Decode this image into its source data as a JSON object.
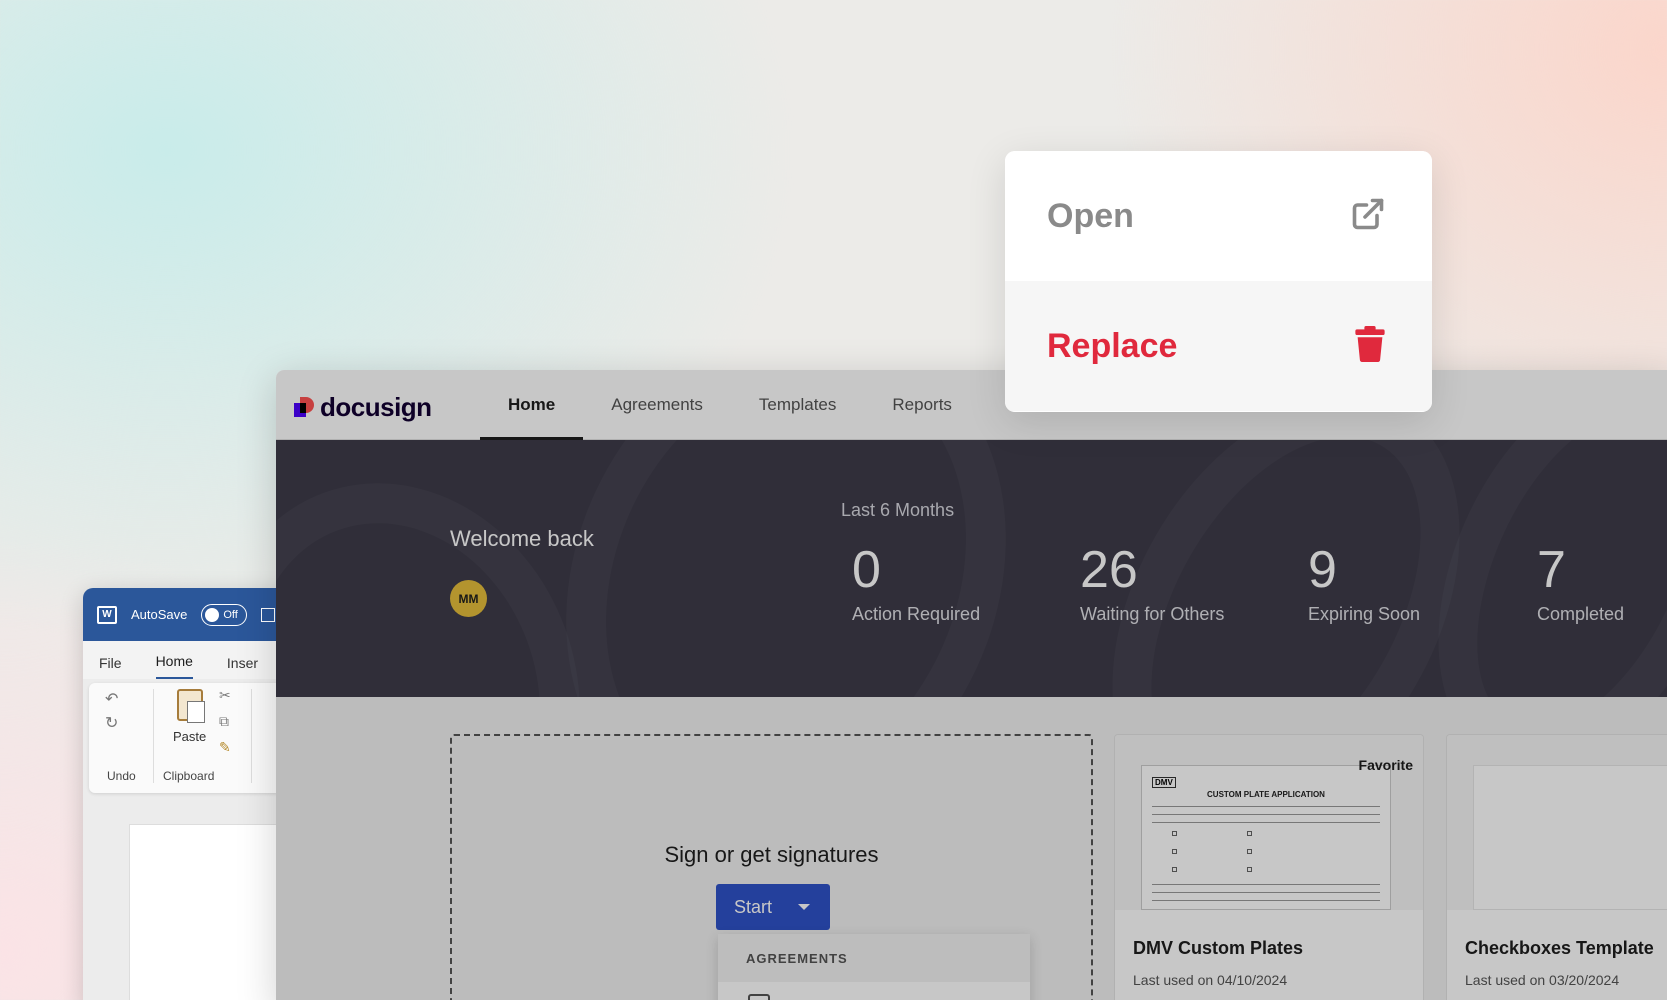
{
  "popup": {
    "items": [
      {
        "label": "Open",
        "icon": "external-link-icon",
        "color": "#8a8a8a"
      },
      {
        "label": "Replace",
        "icon": "trash-icon",
        "color": "#e0293d"
      }
    ]
  },
  "docusign": {
    "logo_text": "docusign",
    "nav": [
      "Home",
      "Agreements",
      "Templates",
      "Reports"
    ],
    "active_nav": "Home",
    "hero": {
      "welcome": "Welcome back",
      "avatar_initials": "MM",
      "period": "Last 6 Months",
      "stats": [
        {
          "value": "0",
          "label": "Action Required"
        },
        {
          "value": "26",
          "label": "Waiting for Others"
        },
        {
          "value": "9",
          "label": "Expiring Soon"
        },
        {
          "value": "7",
          "label": "Completed"
        }
      ]
    },
    "dropzone": {
      "title": "Sign or get signatures",
      "start_label": "Start",
      "menu_header": "AGREEMENTS"
    },
    "templates": [
      {
        "name": "DMV Custom Plates",
        "last_used": "Last used on 04/10/2024",
        "badge": "Favorite",
        "doc_title": "CUSTOM PLATE APPLICATION",
        "doc_logo": "DMV"
      },
      {
        "name": "Checkboxes Template",
        "last_used": "Last used on 03/20/2024"
      }
    ]
  },
  "word": {
    "autosave_label": "AutoSave",
    "autosave_state": "Off",
    "tabs": [
      "File",
      "Home",
      "Inser"
    ],
    "active_tab": "Home",
    "groups": [
      "Undo",
      "Clipboard"
    ],
    "paste_label": "Paste"
  },
  "colors": {
    "accent_blue": "#2f52c8",
    "word_blue": "#2b579a",
    "danger_red": "#e0293d",
    "hero_bg": "#3e3c4a"
  }
}
